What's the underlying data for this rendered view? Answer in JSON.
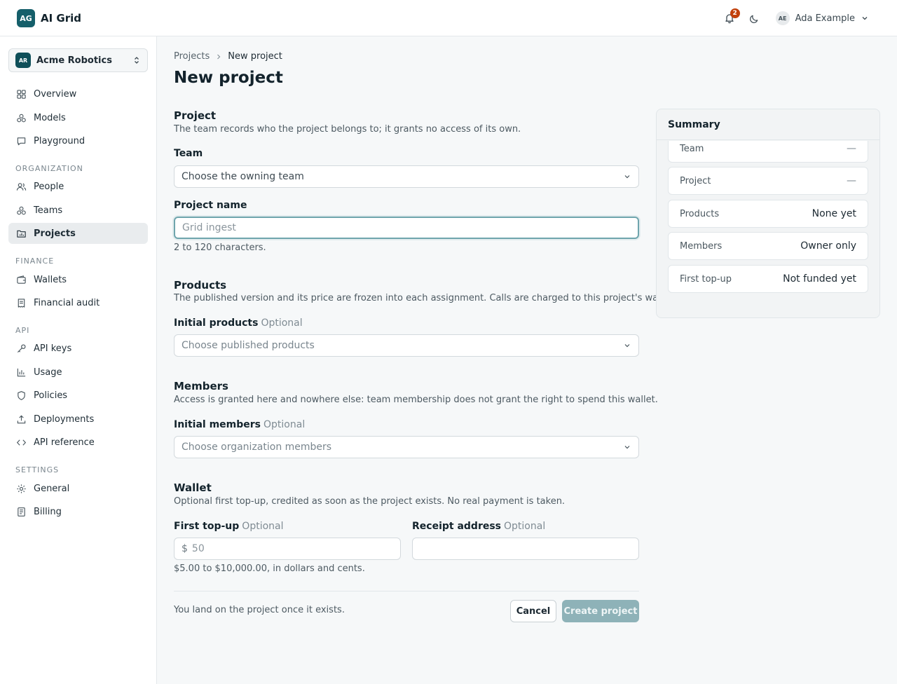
{
  "brand": {
    "badge": "AG",
    "name": "AI Grid"
  },
  "header": {
    "notifications_count": "2",
    "user_initials": "AE",
    "user_name": "Ada Example"
  },
  "org": {
    "badge": "AR",
    "name": "Acme Robotics"
  },
  "nav": {
    "main": [
      {
        "label": "Overview",
        "icon": "grid-icon"
      },
      {
        "label": "Models",
        "icon": "cubes-icon"
      },
      {
        "label": "Playground",
        "icon": "chat-icon"
      }
    ],
    "sections": {
      "organization": "ORGANIZATION",
      "finance": "FINANCE",
      "api": "API",
      "settings": "SETTINGS"
    },
    "organization": [
      {
        "label": "People",
        "icon": "people-icon"
      },
      {
        "label": "Teams",
        "icon": "cubes-icon"
      },
      {
        "label": "Projects",
        "icon": "folder-chart-icon",
        "active": true
      }
    ],
    "finance": [
      {
        "label": "Wallets",
        "icon": "wallet-icon"
      },
      {
        "label": "Financial audit",
        "icon": "receipt-icon"
      }
    ],
    "api": [
      {
        "label": "API keys",
        "icon": "key-icon"
      },
      {
        "label": "Usage",
        "icon": "bar-chart-icon"
      },
      {
        "label": "Policies",
        "icon": "shield-icon"
      },
      {
        "label": "Deployments",
        "icon": "upload-icon"
      },
      {
        "label": "API reference",
        "icon": "code-icon"
      }
    ],
    "settings": [
      {
        "label": "General",
        "icon": "gear-icon"
      },
      {
        "label": "Billing",
        "icon": "document-icon"
      }
    ]
  },
  "breadcrumb": {
    "parent": "Projects",
    "current": "New project"
  },
  "page_title": "New project",
  "form": {
    "project": {
      "title": "Project",
      "desc": "The team records who the project belongs to; it grants no access of its own.",
      "team_label": "Team",
      "team_placeholder": "Choose the owning team",
      "name_label": "Project name",
      "name_placeholder": "Grid ingest",
      "name_hint": "2 to 120 characters."
    },
    "products": {
      "title": "Products",
      "desc": "The published version and its price are frozen into each assignment. Calls are charged to this project's wallet.",
      "label": "Initial products",
      "optional": "Optional",
      "placeholder": "Choose published products"
    },
    "members": {
      "title": "Members",
      "desc": "Access is granted here and nowhere else: team membership does not grant the right to spend this wallet.",
      "label": "Initial members",
      "optional": "Optional",
      "placeholder": "Choose organization members"
    },
    "wallet": {
      "title": "Wallet",
      "desc": "Optional first top-up, credited as soon as the project exists. No real payment is taken.",
      "topup_label": "First top-up",
      "topup_optional": "Optional",
      "currency": "$",
      "topup_placeholder": "50",
      "receipt_label": "Receipt address",
      "receipt_optional": "Optional",
      "hint": "$5.00 to $10,000.00, in dollars and cents."
    },
    "footer_note": "You land on the project once it exists.",
    "cancel": "Cancel",
    "create": "Create project"
  },
  "summary": {
    "title": "Summary",
    "rows": [
      {
        "key": "Team",
        "value": "—"
      },
      {
        "key": "Project",
        "value": "—"
      },
      {
        "key": "Products",
        "value": "None yet"
      },
      {
        "key": "Members",
        "value": "Owner only"
      },
      {
        "key": "First top-up",
        "value": "Not funded yet"
      }
    ]
  },
  "colors": {
    "brand": "#155f6a",
    "badge": "#c2410c",
    "primary_disabled": "#8eb2b8"
  }
}
